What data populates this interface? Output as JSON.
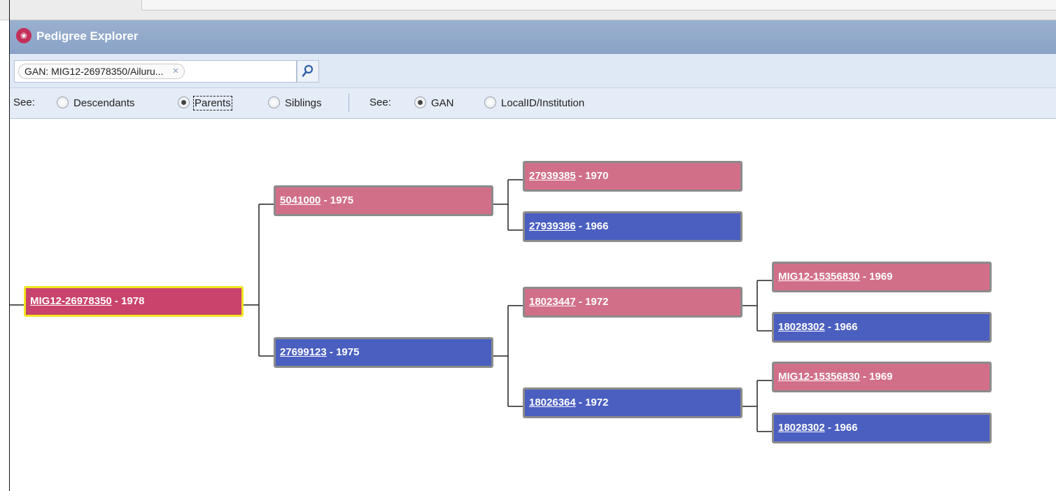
{
  "app": {
    "title": "Pedigree Explorer",
    "icon": "pedigree-icon",
    "colors": {
      "female": "#d16f89",
      "male": "#4b5fc0",
      "selected": "#c9436c",
      "selected_border": "#f0e51f",
      "titlebar": "#8aa3c7"
    }
  },
  "search": {
    "token": "GAN: MIG12-26978350/Ailuru...",
    "token_remove": "×",
    "button_icon": "search-icon"
  },
  "options": {
    "relation_label": "See:",
    "relations": [
      {
        "label": "Descendants",
        "checked": false
      },
      {
        "label": "Parents",
        "checked": true
      },
      {
        "label": "Siblings",
        "checked": false
      }
    ],
    "id_label": "See:",
    "id_modes": [
      {
        "label": "GAN",
        "checked": true
      },
      {
        "label": "LocalID/Institution",
        "checked": false
      }
    ]
  },
  "tree": {
    "separator": " - ",
    "nodes": [
      {
        "id": "MIG12-26978350",
        "year": "1978",
        "sex": "female",
        "selected": true
      },
      {
        "id": "5041000",
        "year": "1975",
        "sex": "female"
      },
      {
        "id": "27699123",
        "year": "1975",
        "sex": "male"
      },
      {
        "id": "27939385",
        "year": "1970",
        "sex": "female"
      },
      {
        "id": "27939386",
        "year": "1966",
        "sex": "male"
      },
      {
        "id": "18023447",
        "year": "1972",
        "sex": "female"
      },
      {
        "id": "18026364",
        "year": "1972",
        "sex": "male"
      },
      {
        "id": "MIG12-15356830",
        "year": "1969",
        "sex": "female"
      },
      {
        "id": "18028302",
        "year": "1966",
        "sex": "male"
      },
      {
        "id": "MIG12-15356830",
        "year": "1969",
        "sex": "female"
      },
      {
        "id": "18028302",
        "year": "1966",
        "sex": "male"
      }
    ]
  }
}
